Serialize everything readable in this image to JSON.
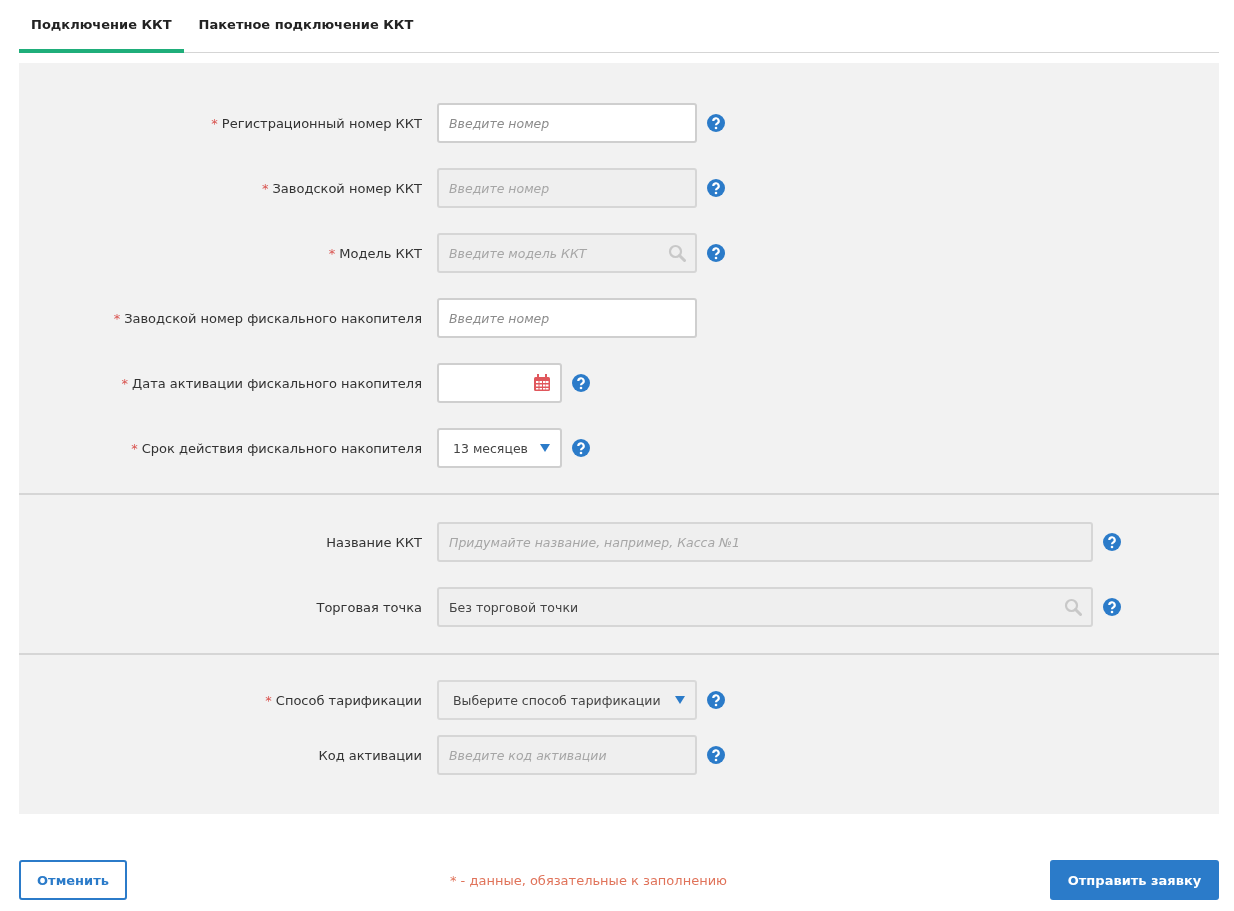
{
  "tabs": [
    {
      "label": "Подключение ККТ",
      "selected": true
    },
    {
      "label": "Пакетное подключение ККТ",
      "selected": false
    }
  ],
  "sections": [
    {
      "fields": [
        {
          "required_mark": "*",
          "label": "Регистрационный номер ККТ",
          "kind": "text",
          "placeholder": "Введите номер",
          "disabled": false,
          "help": true
        },
        {
          "required_mark": "*",
          "label": "Заводской номер ККТ",
          "kind": "text",
          "placeholder": "Введите номер",
          "disabled": true,
          "help": true
        },
        {
          "required_mark": "*",
          "label": "Модель ККТ",
          "kind": "search",
          "placeholder": "Введите модель ККТ",
          "disabled": true,
          "help": true
        },
        {
          "required_mark": "*",
          "label": "Заводской номер фискального накопителя",
          "kind": "text",
          "placeholder": "Введите номер",
          "disabled": false,
          "help": false
        },
        {
          "required_mark": "*",
          "label": "Дата активации фискального накопителя",
          "kind": "date",
          "disabled": false,
          "help": true
        },
        {
          "required_mark": "*",
          "label": "Срок действия фискального накопителя",
          "kind": "select",
          "value": "13 месяцев",
          "disabled": false,
          "help": true
        }
      ]
    },
    {
      "fields": [
        {
          "label": "Название ККТ",
          "kind": "text",
          "placeholder": "Придумайте название, например, Касса №1",
          "disabled": true,
          "help": true
        },
        {
          "label": "Торговая точка",
          "kind": "search",
          "value": "Без торговой точки",
          "disabled": true,
          "help": true
        }
      ]
    },
    {
      "fields": [
        {
          "required_mark": "*",
          "label": "Способ тарификации",
          "kind": "select",
          "value": "Выберите способ тарификации",
          "disabled": true,
          "help": true
        },
        {
          "label": "Код активации",
          "kind": "text",
          "placeholder": "Введите код активации",
          "disabled": true,
          "help": true
        }
      ]
    }
  ],
  "footer": {
    "cancel": "Отменить",
    "note": "* - данные, обязательные к заполнению",
    "submit": "Отправить заявку"
  }
}
